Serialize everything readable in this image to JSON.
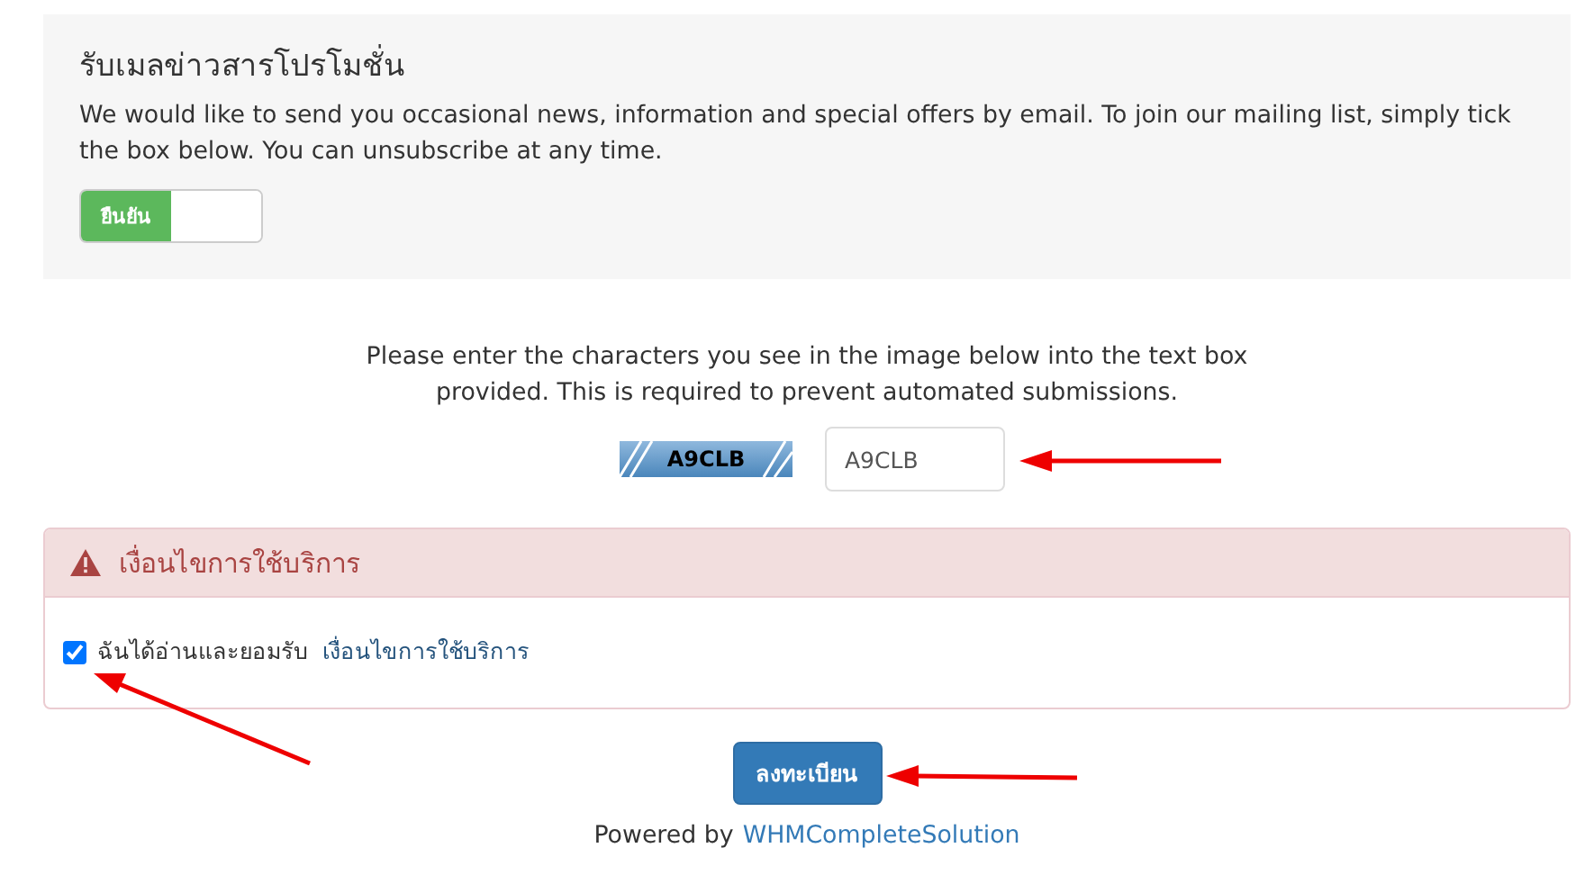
{
  "marketing": {
    "title": "รับเมลข่าวสารโปรโมชั่น",
    "text": "We would like to send you occasional news, information and special offers by email. To join our mailing list, simply tick the box below. You can unsubscribe at any time.",
    "toggle": {
      "label": "ยืนยัน",
      "on": true
    }
  },
  "captcha": {
    "instructions": "Please enter the characters you see in the image below into the text box provided. This is required to prevent automated submissions.",
    "image_text": "A9CLB",
    "value": "A9CLB"
  },
  "terms": {
    "title": "เงื่อนไขการใช้บริการ",
    "checkbox": {
      "label": "ฉันได้อ่านและยอมรับ",
      "link": "เงื่อนไขการใช้บริการ",
      "checked": true
    }
  },
  "submit": "ลงทะเบียน",
  "footer": {
    "text": "Powered by",
    "link": "WHMCompleteSolution"
  }
}
